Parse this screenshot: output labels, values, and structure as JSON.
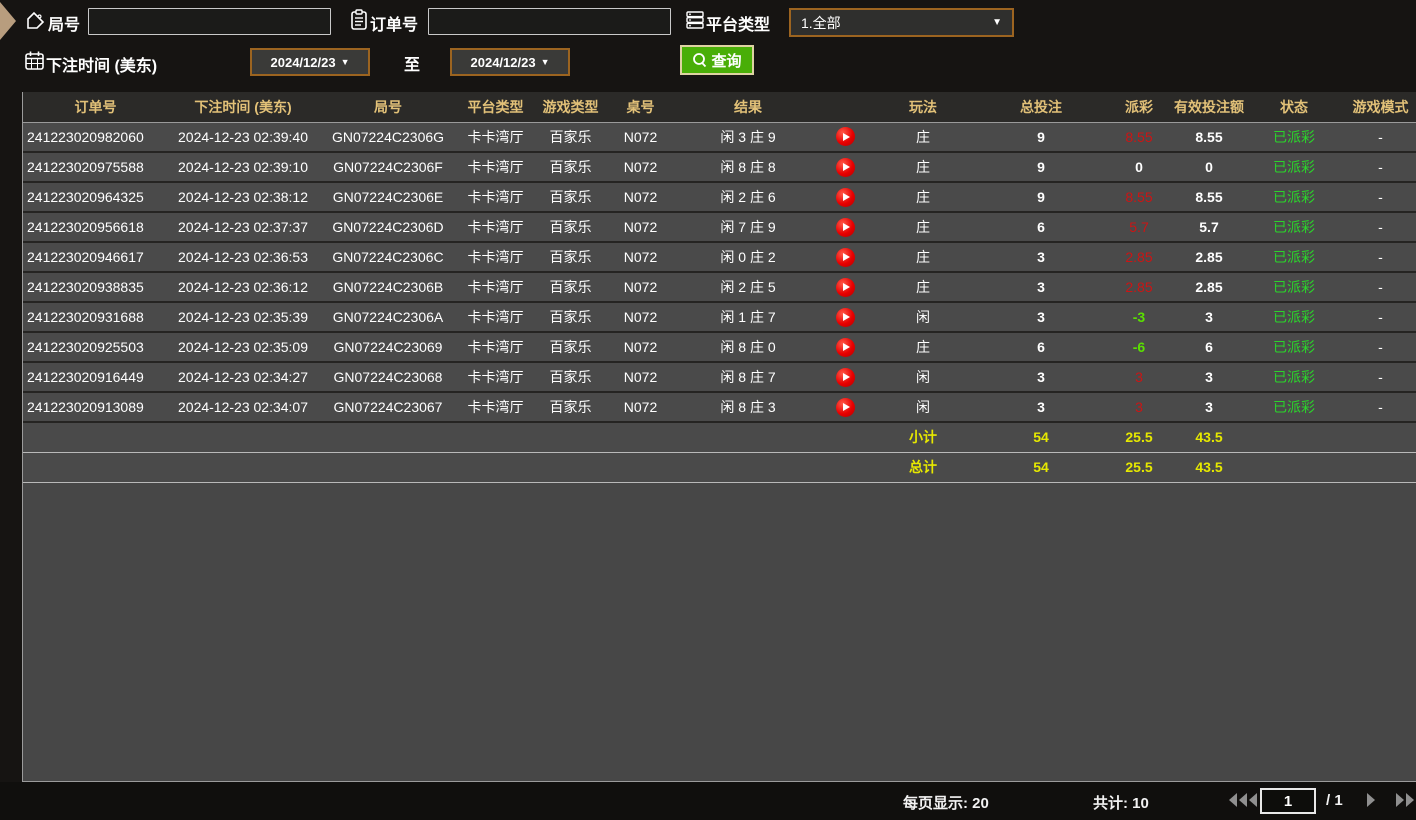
{
  "colors": {
    "accent_gold": "#e2c178",
    "payout_red": "#cc1414",
    "payout_green": "#5ae000",
    "status_green": "#2bd42b",
    "summary_yellow": "#e6e800",
    "query_green": "#49ae07",
    "border_brown": "#9c6420"
  },
  "filters": {
    "game_no_label": "局号",
    "order_no_label": "订单号",
    "platform_label": "平台类型",
    "platform_value": "1.全部",
    "bet_time_label": "下注时间 (美东)",
    "date_from": "2024/12/23",
    "to_label": "至",
    "date_to": "2024/12/23",
    "query_label": "查询",
    "game_no_value": "",
    "order_no_value": ""
  },
  "table": {
    "headers": [
      "订单号",
      "下注时间 (美东)",
      "局号",
      "平台类型",
      "游戏类型",
      "桌号",
      "结果",
      "玩法",
      "总投注",
      "派彩",
      "有效投注额",
      "状态",
      "游戏模式"
    ],
    "rows": [
      {
        "order": "241223020982060",
        "time": "2024-12-23 02:39:40",
        "round": "GN07224C2306G",
        "platform": "卡卡湾厅",
        "game": "百家乐",
        "table_no": "N072",
        "result": "闲 3 庄 9",
        "play": "庄",
        "bet": "9",
        "payout": "8.55",
        "payout_tone": "pos",
        "valid": "8.55",
        "status": "已派彩",
        "mode": "-"
      },
      {
        "order": "241223020975588",
        "time": "2024-12-23 02:39:10",
        "round": "GN07224C2306F",
        "platform": "卡卡湾厅",
        "game": "百家乐",
        "table_no": "N072",
        "result": "闲 8 庄 8",
        "play": "庄",
        "bet": "9",
        "payout": "0",
        "payout_tone": "zero",
        "valid": "0",
        "status": "已派彩",
        "mode": "-"
      },
      {
        "order": "241223020964325",
        "time": "2024-12-23 02:38:12",
        "round": "GN07224C2306E",
        "platform": "卡卡湾厅",
        "game": "百家乐",
        "table_no": "N072",
        "result": "闲 2 庄 6",
        "play": "庄",
        "bet": "9",
        "payout": "8.55",
        "payout_tone": "pos",
        "valid": "8.55",
        "status": "已派彩",
        "mode": "-"
      },
      {
        "order": "241223020956618",
        "time": "2024-12-23 02:37:37",
        "round": "GN07224C2306D",
        "platform": "卡卡湾厅",
        "game": "百家乐",
        "table_no": "N072",
        "result": "闲 7 庄 9",
        "play": "庄",
        "bet": "6",
        "payout": "5.7",
        "payout_tone": "pos",
        "valid": "5.7",
        "status": "已派彩",
        "mode": "-"
      },
      {
        "order": "241223020946617",
        "time": "2024-12-23 02:36:53",
        "round": "GN07224C2306C",
        "platform": "卡卡湾厅",
        "game": "百家乐",
        "table_no": "N072",
        "result": "闲 0 庄 2",
        "play": "庄",
        "bet": "3",
        "payout": "2.85",
        "payout_tone": "pos",
        "valid": "2.85",
        "status": "已派彩",
        "mode": "-"
      },
      {
        "order": "241223020938835",
        "time": "2024-12-23 02:36:12",
        "round": "GN07224C2306B",
        "platform": "卡卡湾厅",
        "game": "百家乐",
        "table_no": "N072",
        "result": "闲 2 庄 5",
        "play": "庄",
        "bet": "3",
        "payout": "2.85",
        "payout_tone": "pos",
        "valid": "2.85",
        "status": "已派彩",
        "mode": "-"
      },
      {
        "order": "241223020931688",
        "time": "2024-12-23 02:35:39",
        "round": "GN07224C2306A",
        "platform": "卡卡湾厅",
        "game": "百家乐",
        "table_no": "N072",
        "result": "闲 1 庄 7",
        "play": "闲",
        "bet": "3",
        "payout": "-3",
        "payout_tone": "neg",
        "valid": "3",
        "status": "已派彩",
        "mode": "-"
      },
      {
        "order": "241223020925503",
        "time": "2024-12-23 02:35:09",
        "round": "GN07224C23069",
        "platform": "卡卡湾厅",
        "game": "百家乐",
        "table_no": "N072",
        "result": "闲 8 庄 0",
        "play": "庄",
        "bet": "6",
        "payout": "-6",
        "payout_tone": "neg",
        "valid": "6",
        "status": "已派彩",
        "mode": "-"
      },
      {
        "order": "241223020916449",
        "time": "2024-12-23 02:34:27",
        "round": "GN07224C23068",
        "platform": "卡卡湾厅",
        "game": "百家乐",
        "table_no": "N072",
        "result": "闲 8 庄 7",
        "play": "闲",
        "bet": "3",
        "payout": "3",
        "payout_tone": "pos",
        "valid": "3",
        "status": "已派彩",
        "mode": "-"
      },
      {
        "order": "241223020913089",
        "time": "2024-12-23 02:34:07",
        "round": "GN07224C23067",
        "platform": "卡卡湾厅",
        "game": "百家乐",
        "table_no": "N072",
        "result": "闲 8 庄 3",
        "play": "闲",
        "bet": "3",
        "payout": "3",
        "payout_tone": "pos",
        "valid": "3",
        "status": "已派彩",
        "mode": "-"
      }
    ],
    "subtotal": {
      "label": "小计",
      "bet": "54",
      "payout": "25.5",
      "valid": "43.5"
    },
    "total": {
      "label": "总计",
      "bet": "54",
      "payout": "25.5",
      "valid": "43.5"
    }
  },
  "footer": {
    "per_page_label": "每页显示: 20",
    "total_label": "共计: 10",
    "page_value": "1",
    "page_total": "/  1"
  }
}
